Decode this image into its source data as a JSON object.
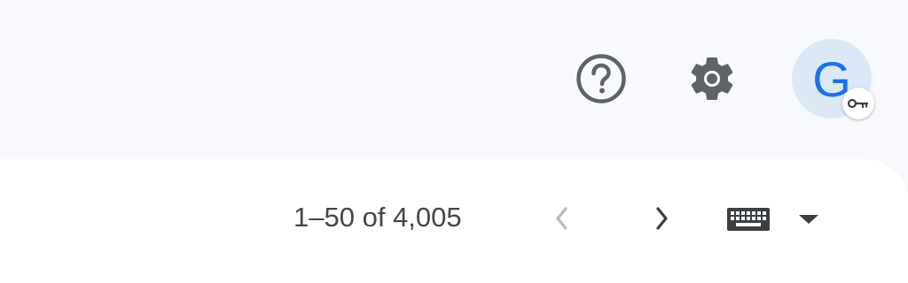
{
  "header": {
    "help_icon": "help-circle-icon",
    "settings_icon": "gear-icon",
    "account": {
      "avatar_letter": "G",
      "badge_icon": "key-icon"
    }
  },
  "toolbar": {
    "pagination_label": "1–50 of 4,005",
    "prev_icon": "chevron-left-icon",
    "next_icon": "chevron-right-icon",
    "input_tools_icon": "keyboard-icon",
    "input_tools_menu_icon": "caret-down-icon"
  },
  "colors": {
    "background": "#f8f9fc",
    "panel": "#ffffff",
    "icon": "#5f6368",
    "icon_disabled": "#b8bbbf",
    "text": "#444746",
    "accent": "#1a73e8",
    "avatar_bg": "#dde8f7"
  }
}
